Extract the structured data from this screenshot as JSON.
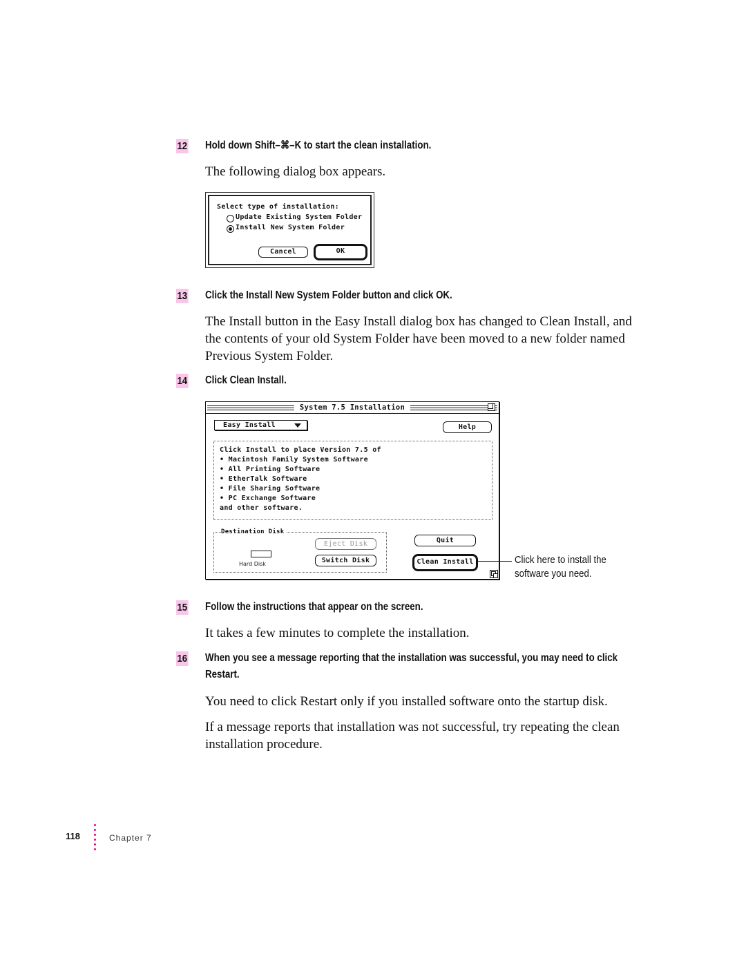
{
  "steps": [
    {
      "number": "12",
      "heading": "Hold down Shift–⌘–K to start the clean installation.",
      "paragraphs": [
        "The following dialog box appears."
      ]
    },
    {
      "number": "13",
      "heading": "Click the Install New System Folder button and click OK.",
      "paragraphs": [
        "The Install button in the Easy Install dialog box has changed to Clean Install, and the contents of your old System Folder have been moved to a new folder named Previous System Folder."
      ]
    },
    {
      "number": "14",
      "heading": "Click Clean Install.",
      "paragraphs": []
    },
    {
      "number": "15",
      "heading": "Follow the instructions that appear on the screen.",
      "paragraphs": [
        "It takes a few minutes to complete the installation."
      ]
    },
    {
      "number": "16",
      "heading": "When you see a message reporting that the installation was successful, you may need to click Restart.",
      "paragraphs": [
        "You need to click Restart only if you installed software onto the startup disk.",
        "If a message reports that installation was not successful, try repeating the clean installation procedure."
      ]
    }
  ],
  "dialog_install_type": {
    "prompt": "Select type of installation:",
    "options": [
      {
        "label": "Update Existing System Folder",
        "selected": false
      },
      {
        "label": "Install New System Folder",
        "selected": true
      }
    ],
    "cancel_label": "Cancel",
    "ok_label": "OK"
  },
  "installer_window": {
    "title": "System 7.5 Installation",
    "mode_popup": "Easy Install",
    "help_label": "Help",
    "description_lines": [
      "Click Install to place Version 7.5 of",
      "• Macintosh Family System Software",
      "• All Printing Software",
      "• EtherTalk Software",
      "• File Sharing Software",
      "• PC Exchange Software",
      "and other software."
    ],
    "destination_label": "Destination Disk",
    "disk_name": "Hard Disk",
    "eject_label": "Eject Disk",
    "switch_label": "Switch Disk",
    "quit_label": "Quit",
    "clean_install_label": "Clean Install"
  },
  "callout": {
    "line1": "Click here to install the",
    "line2": "software you need."
  },
  "footer": {
    "page_number": "118",
    "chapter": "Chapter 7",
    "accent_color": "#e6007e"
  },
  "colors": {
    "step_badge": "#f7c6e8"
  }
}
